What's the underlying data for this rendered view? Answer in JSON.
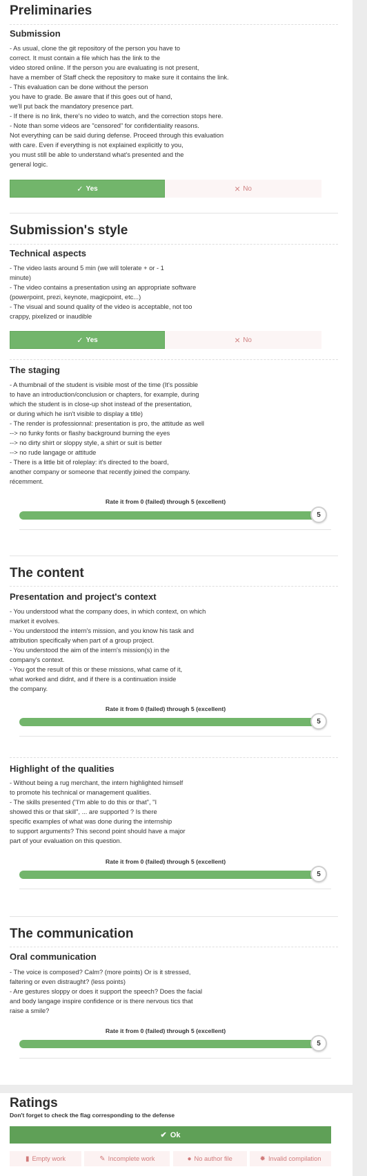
{
  "colors": {
    "green": "#72b56b",
    "ok_green": "#5fa057",
    "no_bg": "#fcf5f5",
    "no_text": "#d08383"
  },
  "rate_label": "Rate it from 0 (failed) through 5 (excellent)",
  "sections": {
    "preliminaries": {
      "title": "Preliminaries",
      "submission": {
        "title": "Submission",
        "description": "- As usual, clone the git repository of the person you have to\ncorrect. It must contain a file which has the link to the\nvideo stored online. If the person you are evaluating is not present,\nhave a member of Staff check the repository to make sure it contains the link.\n- This evaluation can be done without the person\nyou have to grade. Be aware that if this goes out of hand,\nwe'll put back the mandatory presence part.\n- If there is no link, there's no video to watch, and the correction stops here.\n- Note than some videos are \"censored\" for confidentiality reasons.\nNot everything can be said during defense. Proceed through this evaluation\nwith care. Even if everything is not explained explicitly to you,\nyou must still be able to understand what's presented and the\ngeneral logic.",
        "yes_label": "Yes",
        "no_label": "No"
      }
    },
    "style": {
      "title": "Submission's style",
      "technical": {
        "title": "Technical aspects",
        "description": "- The video lasts around 5 min (we will tolerate + or - 1\nminute)\n- The video contains a presentation using an appropriate software\n(powerpoint, prezi, keynote, magicpoint, etc...)\n- The visual and sound quality of the video is acceptable, not too\ncrappy, pixelized or inaudible",
        "yes_label": "Yes",
        "no_label": "No"
      },
      "staging": {
        "title": "The staging",
        "description": "- A thumbnail of the student is visible most of the time (It's possible\nto have an introduction/conclusion or chapters, for example, during\nwhich the student is in close-up shot instead of the presentation,\nor during which he isn't visible to display a title)\n- The render is professionnal: presentation is pro, the attitude as well\n--> no funky fonts or flashy background burning the eyes\n--> no dirty shirt or sloppy style, a shirt or suit is better\n--> no rude langage or attitude\n- There is a little bit of roleplay: it's directed to the board,\nanother company or someone that recently joined the company.\nrécemment.",
        "rating": "5"
      }
    },
    "content": {
      "title": "The content",
      "context": {
        "title": "Presentation and project's context",
        "description": "- You understood what the company does, in which context, on which\nmarket it evolves.\n- You understood the intern's mission, and you know his task and\nattribution specifically when part of a group project.\n- You understood the aim of the intern's mission(s) in the\ncompany's context.\n- You got the result of this or these missions, what came of it,\nwhat worked and didnt, and if there is a continuation inside\nthe company.",
        "rating": "5"
      },
      "qualities": {
        "title": "Highlight of the qualities",
        "description": "- Without being a rug merchant, the intern highlighted himself\nto promote his technical or management qualities.\n- The skills presented (\"I'm able to do this or that\", \"I\nshowed this or that skill\", ... are supported ? Is there\nspecific examples of what was done during the internship\nto support arguments? This second point should have a major\npart of your evaluation on this question.",
        "rating": "5"
      }
    },
    "communication": {
      "title": "The communication",
      "oral": {
        "title": "Oral communication",
        "description": "- The voice is composed? Calm? (more points) Or is it stressed,\nfaltering or even distraught? (less points)\n- Are gestures sloppy or does it support the speech? Does the facial\nand body langage inspire confidence or is there nervous tics that\nraise a smile?",
        "rating": "5"
      }
    }
  },
  "ratings": {
    "title": "Ratings",
    "note": "Don't forget to check the flag corresponding to the defense",
    "ok_label": "Ok",
    "flags": [
      {
        "label": "Empty work",
        "icon": "file-icon"
      },
      {
        "label": "Incomplete work",
        "icon": "file-pen-icon"
      },
      {
        "label": "No author file",
        "icon": "speech-bubble-icon"
      },
      {
        "label": "Invalid compilation",
        "icon": "bug-icon"
      }
    ]
  }
}
